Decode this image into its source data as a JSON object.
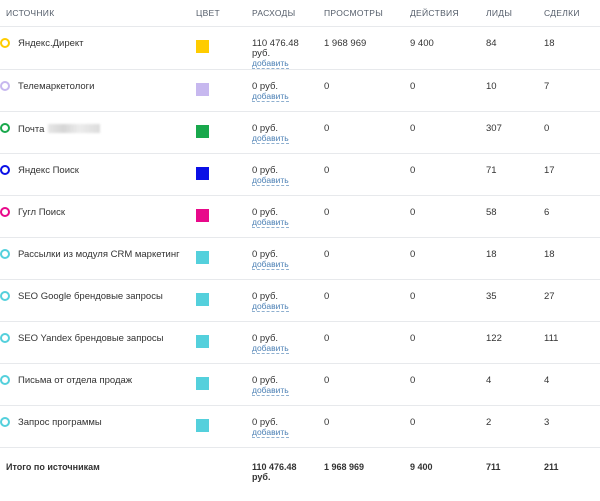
{
  "headers": {
    "source": "ИСТОЧНИК",
    "color": "ЦВЕТ",
    "expenses": "РАСХОДЫ",
    "views": "ПРОСМОТРЫ",
    "actions": "ДЕЙСТВИЯ",
    "leads": "ЛИДЫ",
    "deals": "СДЕЛКИ"
  },
  "add_label": "добавить",
  "rows": [
    {
      "name": "Яндекс.Директ",
      "color": "#ffcc00",
      "expense_amount": "110 476.48",
      "expense_unit": "руб.",
      "views": "1 968 969",
      "actions": "9 400",
      "leads": "84",
      "deals": "18"
    },
    {
      "name": "Телемаркетологи",
      "color": "#c7b8ef",
      "expense_amount": "0 руб.",
      "expense_unit": "",
      "views": "0",
      "actions": "0",
      "leads": "10",
      "deals": "7"
    },
    {
      "name": "Почта",
      "color": "#19a84c",
      "expense_amount": "0 руб.",
      "expense_unit": "",
      "views": "0",
      "actions": "0",
      "leads": "307",
      "deals": "0"
    },
    {
      "name": "Яндекс Поиск",
      "color": "#0a10e6",
      "expense_amount": "0 руб.",
      "expense_unit": "",
      "views": "0",
      "actions": "0",
      "leads": "71",
      "deals": "17"
    },
    {
      "name": "Гугл Поиск",
      "color": "#e8098a",
      "expense_amount": "0 руб.",
      "expense_unit": "",
      "views": "0",
      "actions": "0",
      "leads": "58",
      "deals": "6"
    },
    {
      "name": "Рассылки из модуля CRM маркетинг",
      "color": "#54d0dc",
      "expense_amount": "0 руб.",
      "expense_unit": "",
      "views": "0",
      "actions": "0",
      "leads": "18",
      "deals": "18"
    },
    {
      "name": "SEO Google брендовые запросы",
      "color": "#54d0dc",
      "expense_amount": "0 руб.",
      "expense_unit": "",
      "views": "0",
      "actions": "0",
      "leads": "35",
      "deals": "27"
    },
    {
      "name": "SEO Yandex брендовые запросы",
      "color": "#54d0dc",
      "expense_amount": "0 руб.",
      "expense_unit": "",
      "views": "0",
      "actions": "0",
      "leads": "122",
      "deals": "111"
    },
    {
      "name": "Письма от отдела продаж",
      "color": "#54d0dc",
      "expense_amount": "0 руб.",
      "expense_unit": "",
      "views": "0",
      "actions": "0",
      "leads": "4",
      "deals": "4"
    },
    {
      "name": "Запрос программы",
      "color": "#54d0dc",
      "expense_amount": "0 руб.",
      "expense_unit": "",
      "views": "0",
      "actions": "0",
      "leads": "2",
      "deals": "3"
    }
  ],
  "total": {
    "label": "Итого по источникам",
    "expense_amount": "110 476.48",
    "expense_unit": "руб.",
    "views": "1 968 969",
    "actions": "9 400",
    "leads": "711",
    "deals": "211"
  }
}
